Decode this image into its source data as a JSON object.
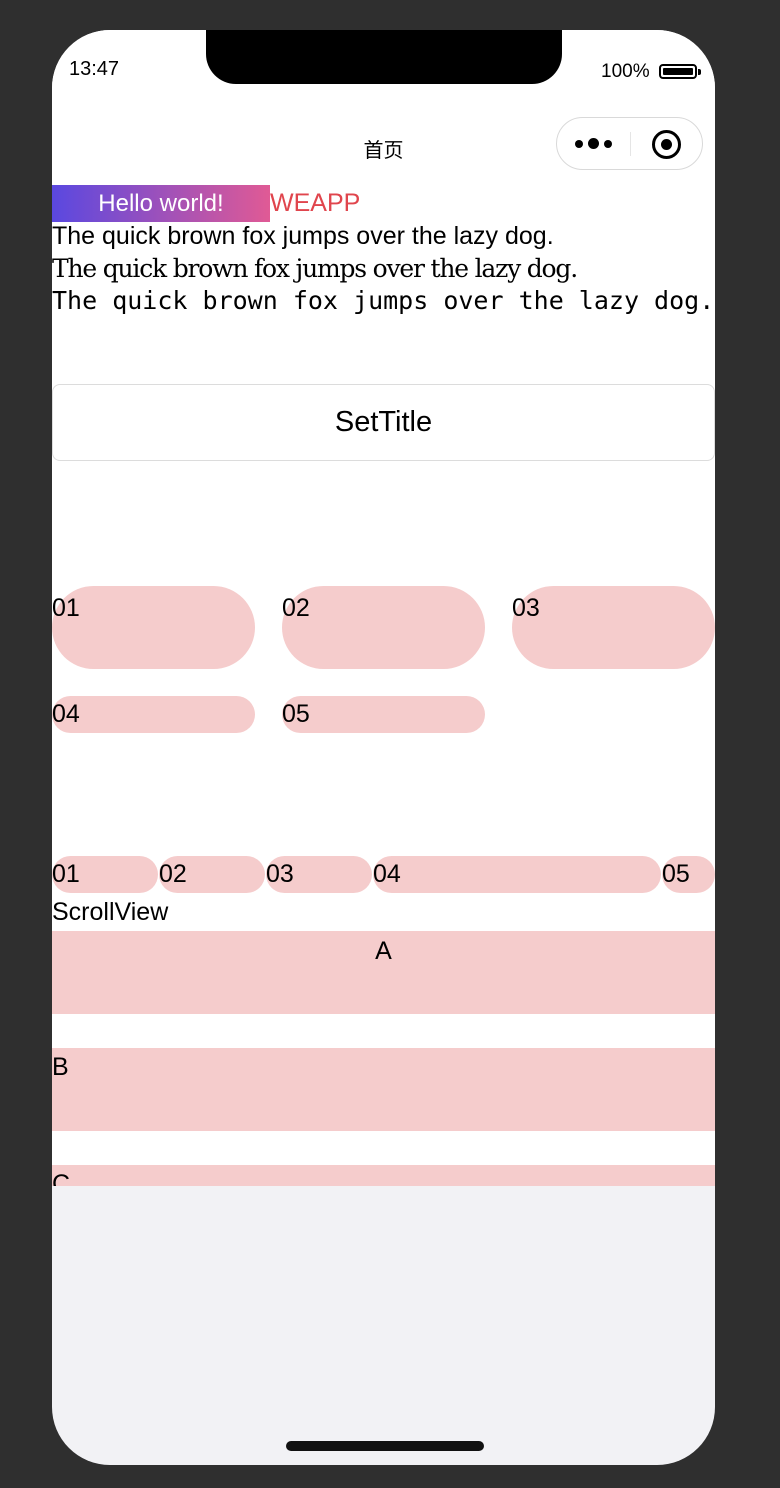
{
  "status_bar": {
    "time": "13:47",
    "battery": "100%"
  },
  "nav": {
    "title": "首页",
    "more_icon": "more-dots-icon",
    "close_icon": "target-circle-icon"
  },
  "hello": {
    "label": "Hello world!",
    "gradient": [
      "#5a48e0",
      "#e05a95"
    ]
  },
  "weapp": {
    "label": "WEAPP",
    "color": "#e0454d"
  },
  "fonts_demo": {
    "sans": "The quick brown fox jumps over the lazy dog.",
    "serif": "The quick brown fox jumps over the lazy dog.",
    "mono": "The quick brown fox jumps over the lazy dog."
  },
  "set_title_button": "SetTitle",
  "grid_items": [
    "01",
    "02",
    "03",
    "04",
    "05"
  ],
  "flex_items": [
    "01",
    "02",
    "03",
    "04",
    "05"
  ],
  "scroll_view": {
    "label": "ScrollView",
    "items": [
      "A",
      "B",
      "C"
    ]
  },
  "colors": {
    "pill": "#f5cccc",
    "background": "#f2f2f5"
  }
}
